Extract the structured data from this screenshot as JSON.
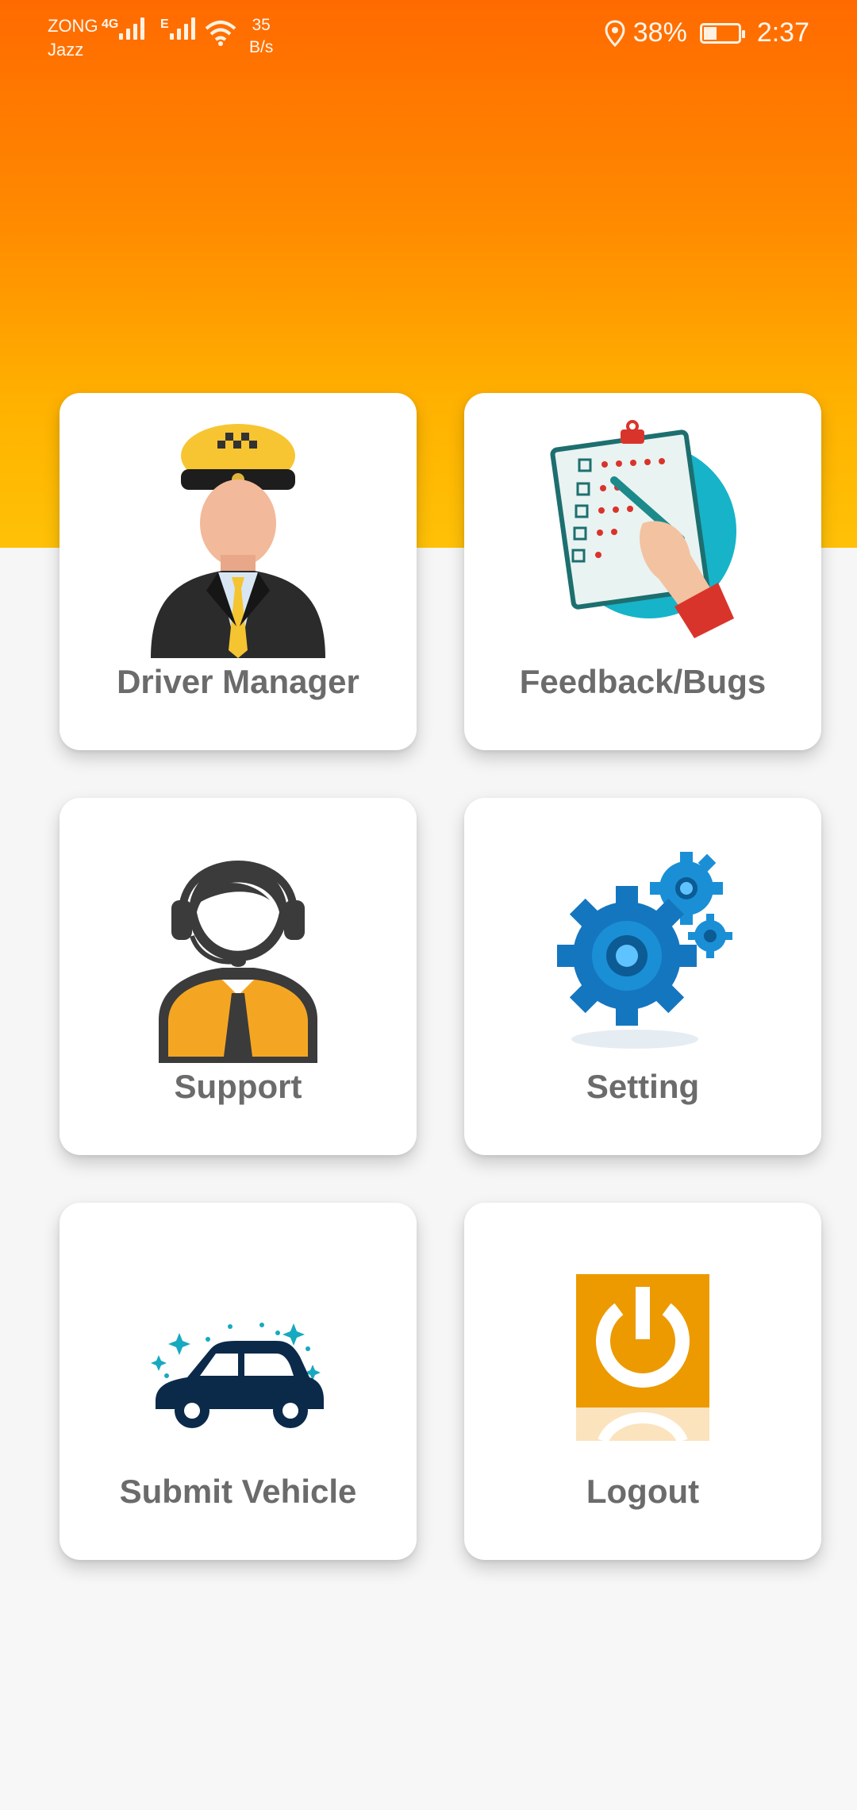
{
  "status_bar": {
    "carrier_top": "ZONG",
    "carrier_bottom": "Jazz",
    "net1": "4G",
    "net2": "E",
    "speed_value": "35",
    "speed_unit": "B/s",
    "battery_percent": "38%",
    "time": "2:37"
  },
  "menu": {
    "driver_manager": "Driver Manager",
    "feedback": "Feedback/Bugs",
    "support": "Support",
    "setting": "Setting",
    "submit_vehicle": "Submit Vehicle",
    "logout": "Logout"
  },
  "colors": {
    "header_top": "#ff6a00",
    "header_bottom": "#ffc107",
    "label_text": "#6b6b6b",
    "logout_orange": "#ec9a00",
    "car_navy": "#0b2a4a",
    "gear_blue": "#1a8fd6"
  },
  "icons": [
    "driver-icon",
    "feedback-clipboard-icon",
    "support-agent-icon",
    "gear-icon",
    "car-icon",
    "power-icon"
  ]
}
